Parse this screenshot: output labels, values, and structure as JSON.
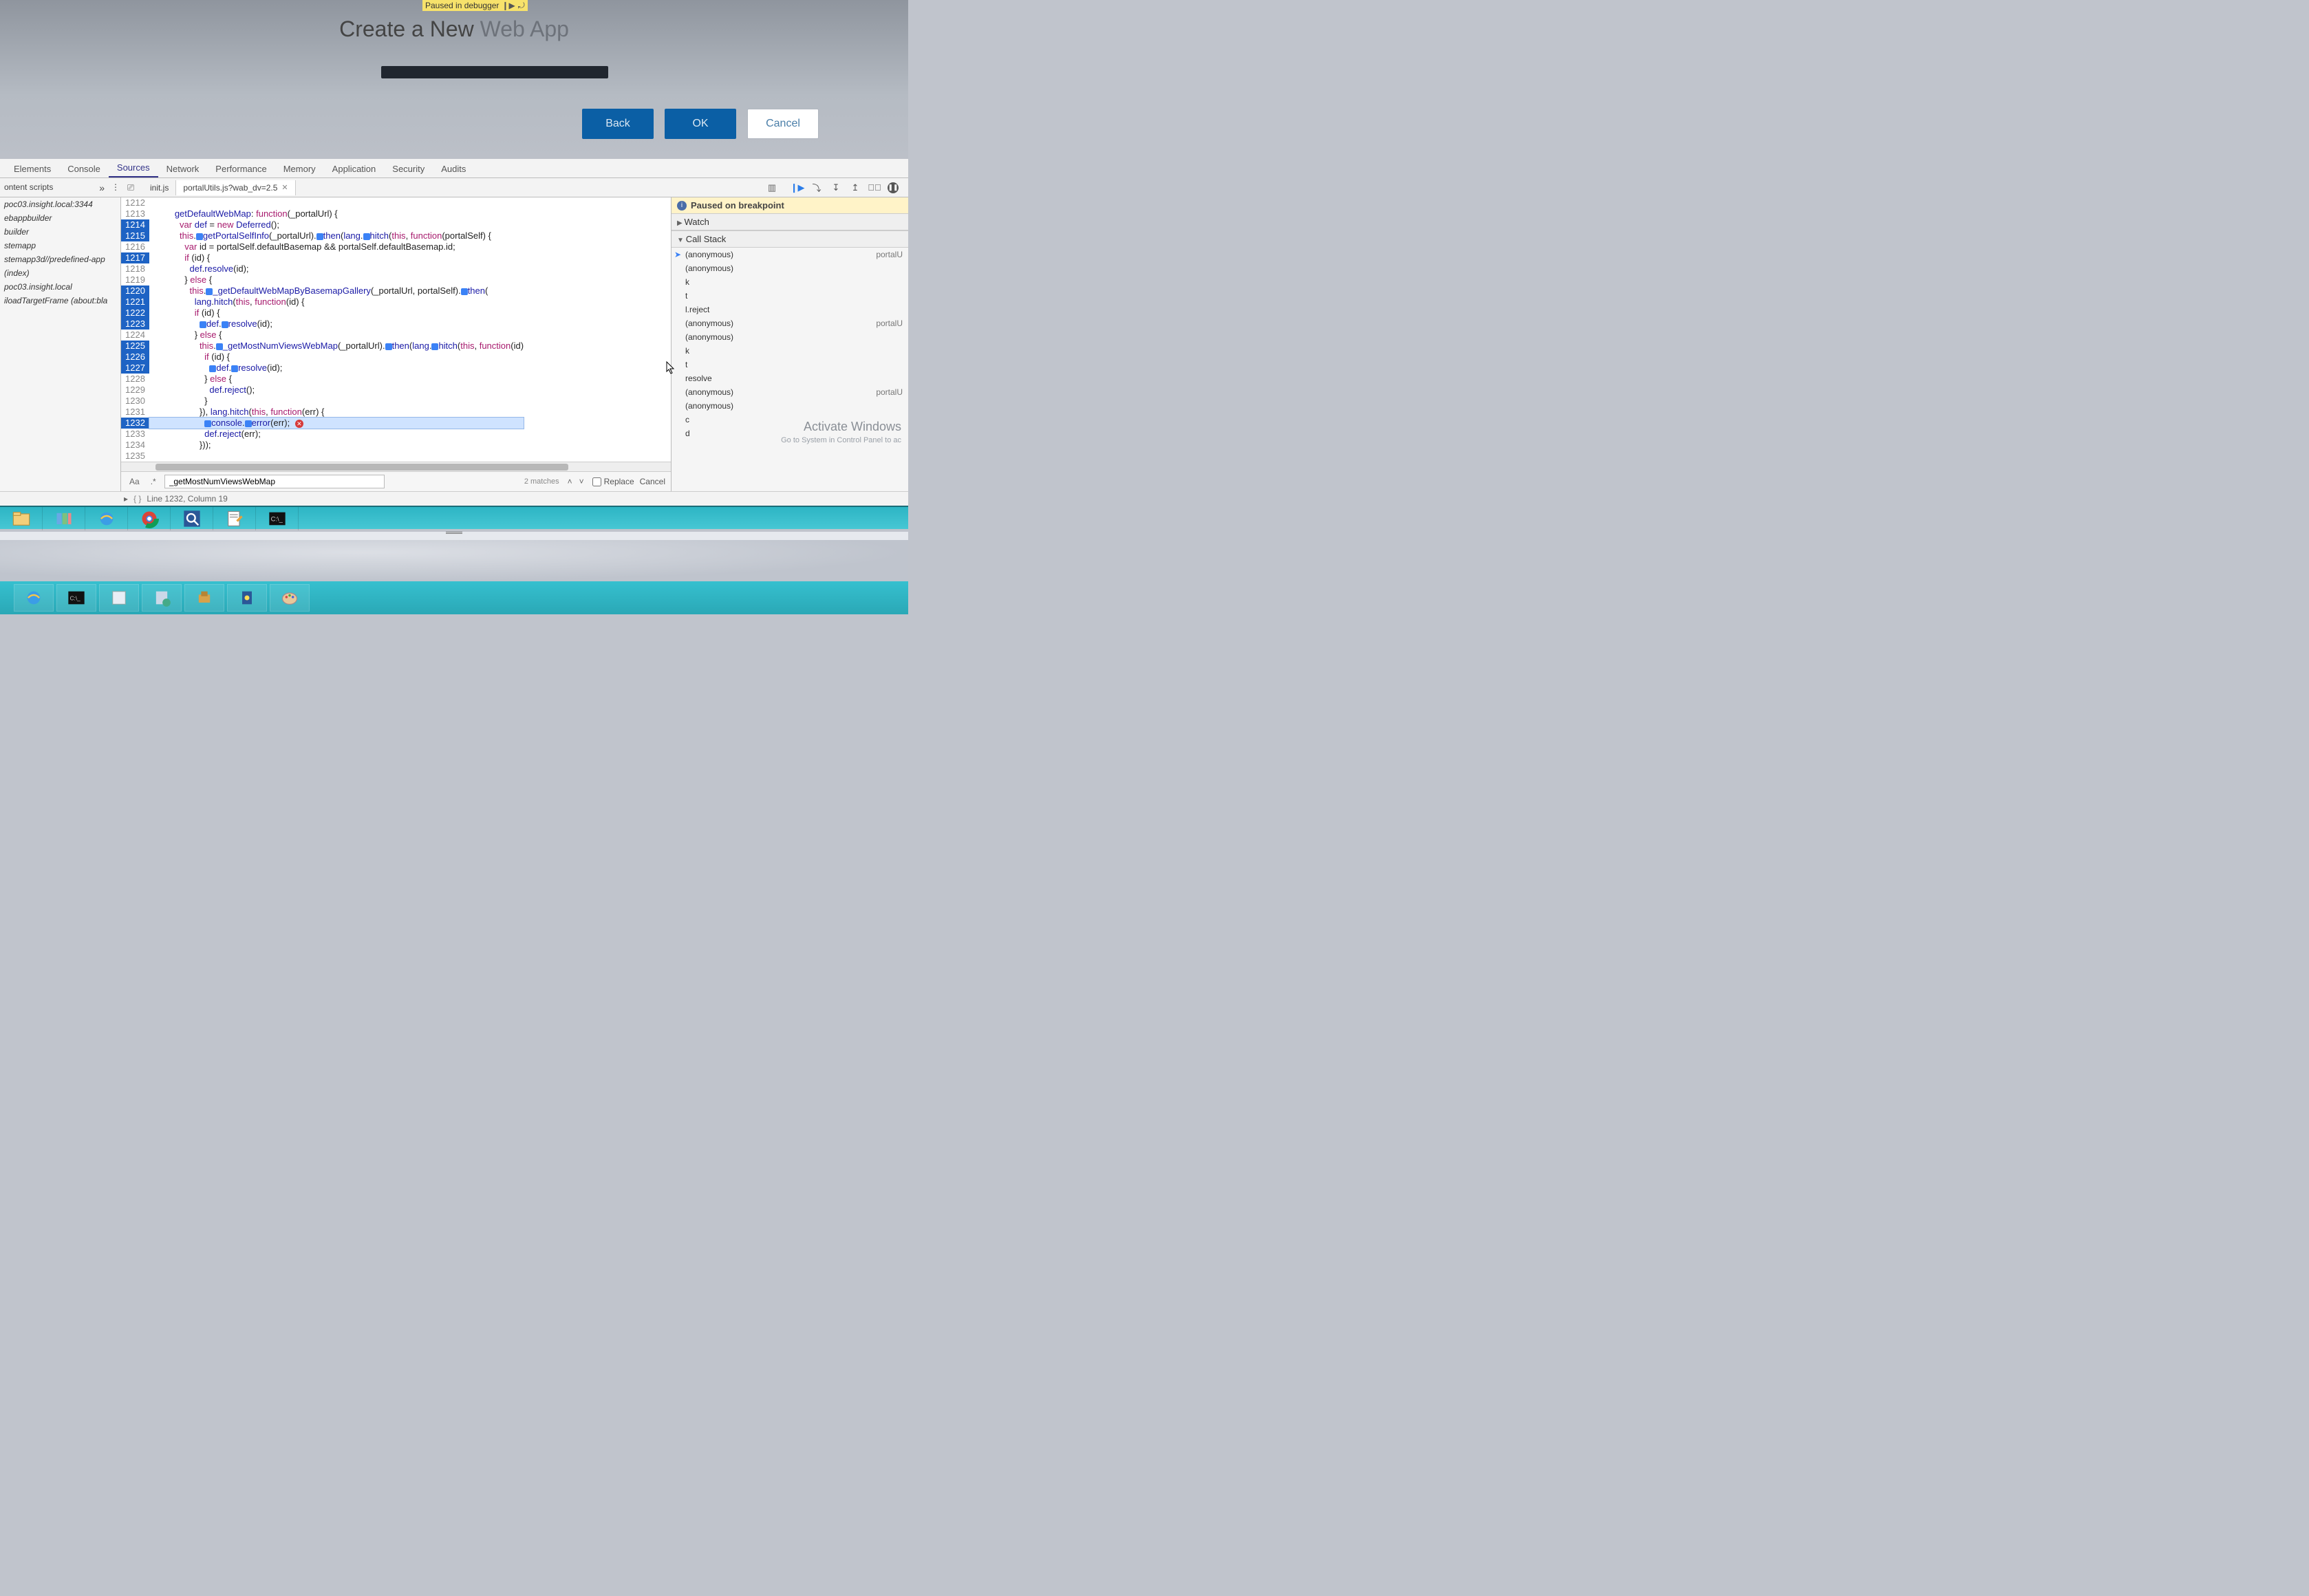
{
  "debugger_badge": {
    "text": "Paused in debugger"
  },
  "dialog": {
    "title_strong": "Create a New",
    "title_light": "Web App",
    "back": "Back",
    "ok": "OK",
    "cancel": "Cancel"
  },
  "devtools": {
    "tabs": [
      "Elements",
      "Console",
      "Sources",
      "Network",
      "Performance",
      "Memory",
      "Application",
      "Security",
      "Audits"
    ],
    "active_tab": "Sources",
    "file_tabs": [
      {
        "label": "init.js",
        "active": false
      },
      {
        "label": "portalUtils.js?wab_dv=2.5",
        "active": true
      }
    ],
    "nav_head": "ontent scripts",
    "nav_items": [
      "poc03.insight.local:3344",
      "ebappbuilder",
      "builder",
      "stemapp",
      "stemapp3d//predefined-app",
      "(index)",
      "poc03.insight.local",
      "iloadTargetFrame (about:bla"
    ],
    "paused_msg": "Paused on breakpoint",
    "watch_label": "Watch",
    "callstack_label": "Call Stack",
    "callstack": [
      {
        "name": "(anonymous)",
        "loc": "portalU",
        "current": true
      },
      {
        "name": "(anonymous)",
        "loc": ""
      },
      {
        "name": "k",
        "loc": ""
      },
      {
        "name": "t",
        "loc": ""
      },
      {
        "name": "l.reject",
        "loc": ""
      },
      {
        "name": "(anonymous)",
        "loc": "portalU"
      },
      {
        "name": "(anonymous)",
        "loc": ""
      },
      {
        "name": "k",
        "loc": ""
      },
      {
        "name": "t",
        "loc": ""
      },
      {
        "name": "resolve",
        "loc": ""
      },
      {
        "name": "(anonymous)",
        "loc": "portalU"
      },
      {
        "name": "(anonymous)",
        "loc": ""
      },
      {
        "name": "c",
        "loc": ""
      },
      {
        "name": "d",
        "loc": ""
      }
    ],
    "activate_windows": "Activate Windows",
    "activate_windows_sub": "Go to System in Control Panel to ac",
    "find": {
      "aa": "Aa",
      "regex": ".*",
      "value": "_getMostNumViewsWebMap",
      "matches": "2 matches",
      "replace": "Replace",
      "cancel": "Cancel"
    },
    "status": "Line 1232, Column 19"
  },
  "code": {
    "lines": [
      {
        "n": 1212,
        "bp": false,
        "t": ""
      },
      {
        "n": 1213,
        "bp": false,
        "t": "getDefaultWebMap: function(_portalUrl) {"
      },
      {
        "n": 1214,
        "bp": true,
        "t": "  var def = new Deferred();"
      },
      {
        "n": 1215,
        "bp": true,
        "t": "  this.▮getPortalSelfInfo(_portalUrl).▮then(lang.▮hitch(this, function(portalSelf) {"
      },
      {
        "n": 1216,
        "bp": false,
        "t": "    var id = portalSelf.defaultBasemap && portalSelf.defaultBasemap.id;"
      },
      {
        "n": 1217,
        "bp": true,
        "t": "    if (id) {"
      },
      {
        "n": 1218,
        "bp": false,
        "t": "      def.resolve(id);"
      },
      {
        "n": 1219,
        "bp": false,
        "t": "    } else {"
      },
      {
        "n": 1220,
        "bp": true,
        "t": "      this.▮_getDefaultWebMapByBasemapGallery(_portalUrl, portalSelf).▮then("
      },
      {
        "n": 1221,
        "bp": true,
        "t": "        lang.hitch(this, function(id) {"
      },
      {
        "n": 1222,
        "bp": true,
        "t": "        if (id) {"
      },
      {
        "n": 1223,
        "bp": true,
        "t": "          ▮def.▮resolve(id);"
      },
      {
        "n": 1224,
        "bp": false,
        "t": "        } else {"
      },
      {
        "n": 1225,
        "bp": true,
        "t": "          this.▮_getMostNumViewsWebMap(_portalUrl).▮then(lang.▮hitch(this, function(id)"
      },
      {
        "n": 1226,
        "bp": true,
        "t": "            if (id) {"
      },
      {
        "n": 1227,
        "bp": true,
        "t": "              ▮def.▮resolve(id);"
      },
      {
        "n": 1228,
        "bp": false,
        "t": "            } else {"
      },
      {
        "n": 1229,
        "bp": false,
        "t": "              def.reject();"
      },
      {
        "n": 1230,
        "bp": false,
        "t": "            }"
      },
      {
        "n": 1231,
        "bp": false,
        "t": "          }), lang.hitch(this, function(err) {"
      },
      {
        "n": 1232,
        "bp": true,
        "t": "            ▮console.▮error(err); ⊗",
        "current": true
      },
      {
        "n": 1233,
        "bp": false,
        "t": "            def.reject(err);"
      },
      {
        "n": 1234,
        "bp": false,
        "t": "          }));"
      },
      {
        "n": 1235,
        "bp": false,
        "t": ""
      }
    ]
  }
}
